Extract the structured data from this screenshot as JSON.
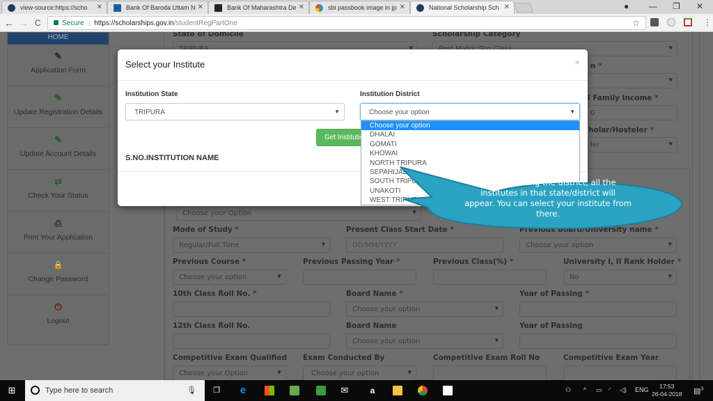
{
  "browser": {
    "tabs": [
      {
        "label": "view-source:https://scho",
        "icon": "nsp-favicon",
        "active": false
      },
      {
        "label": "Bank Of Baroda Uttam N",
        "icon": "bob-favicon",
        "active": false
      },
      {
        "label": "Bank Of Maharashtra De",
        "icon": "bom-favicon",
        "active": false
      },
      {
        "label": "sbi passbook image in jp",
        "icon": "google-favicon",
        "active": false
      },
      {
        "label": "National Scholarship Sch",
        "icon": "nsp-favicon",
        "active": true
      }
    ],
    "close_glyph": "✕",
    "window_controls": {
      "profile": "●",
      "minimize": "—",
      "restore": "❐",
      "close": "✕"
    },
    "nav": {
      "back": "←",
      "forward": "→",
      "reload": "C"
    },
    "address": {
      "secure_label": "Secure",
      "host": "https://scholarships.gov.in",
      "path": "/studentRegPartOne"
    },
    "star": "☆",
    "menu": "⋮"
  },
  "sidebar": {
    "home_label": "HOME",
    "items": [
      {
        "label": "Application Form",
        "icon": "edit-icon",
        "glyph": "✎",
        "color": "#2a2a2a"
      },
      {
        "label": "Update Registration Details",
        "icon": "edit-icon",
        "glyph": "✎",
        "color": "#1f5d1f"
      },
      {
        "label": "Update Account Details",
        "icon": "edit-icon",
        "glyph": "✎",
        "color": "#1f5d1f"
      },
      {
        "label": "Check Your Status",
        "icon": "exchange-icon",
        "glyph": "⇄",
        "color": "#1f5d1f"
      },
      {
        "label": "Print Your Application",
        "icon": "print-icon",
        "glyph": "⎙",
        "color": "#2a2a2a"
      },
      {
        "label": "Change Password",
        "icon": "lock-icon",
        "glyph": "🔒",
        "color": "#2a2a2a"
      },
      {
        "label": "Logout",
        "icon": "power-icon",
        "glyph": "⏻",
        "color": "#6b1010"
      }
    ]
  },
  "form": {
    "state_of_domicile": {
      "label": "State of Domicile",
      "value": "TRIPURA"
    },
    "scholarship_category": {
      "label": "Scholarship Category",
      "value": "Post Matric/Top Class"
    },
    "religion": {
      "label_fragment": "n"
    },
    "annual_family_income": {
      "label_fragment": "l Family Income",
      "value_fragment": "0"
    },
    "day_scholar": {
      "label_fragment": "holar/Hosteler",
      "value_fragment": "ler"
    },
    "course_select": {
      "value": "Choose your Option"
    },
    "mode_of_study": {
      "label": "Mode of Study",
      "value": "Regular/Full Time"
    },
    "present_class_start_date": {
      "label": "Present Class Start Date",
      "placeholder": "DD/MM/YYYY"
    },
    "previous_board": {
      "label": "Previous Board/University name",
      "value": "Choose your option"
    },
    "previous_course": {
      "label": "Previous Course",
      "value": "Choose your option"
    },
    "previous_passing_year": {
      "label": "Previous Passing Year",
      "value": ""
    },
    "previous_class_pct": {
      "label": "Previous Class(%)",
      "value": ""
    },
    "rank_holder": {
      "label": "University I, II Rank Holder",
      "value": "No"
    },
    "roll_10": {
      "label": "10th Class Roll No.",
      "value": ""
    },
    "board_10": {
      "label": "Board Name",
      "value": "Choose your option"
    },
    "year_10": {
      "label": "Year of Passing",
      "value": ""
    },
    "roll_12": {
      "label": "12th Class Roll No.",
      "value": ""
    },
    "board_12": {
      "label": "Board Name",
      "value": "Choose your option"
    },
    "year_12": {
      "label": "Year of Passing",
      "value": ""
    },
    "comp_exam": {
      "label": "Competitive Exam Qualified",
      "value": "Choose your Option"
    },
    "exam_conducted_by": {
      "label": "Exam Conducted By",
      "value": "Choose your option"
    },
    "comp_roll": {
      "label": "Competitive Exam Roll No",
      "value": ""
    },
    "comp_year": {
      "label": "Competitive Exam Year",
      "value": ""
    },
    "required_marker": "*",
    "arrow": "▼"
  },
  "modal": {
    "title": "Select your Institute",
    "close": "×",
    "state_label": "Institution State",
    "state_value": "TRIPURA",
    "district_label": "Institution District",
    "district_value": "Choose your option",
    "get_button": "Get Institutions",
    "table_header": "S.NO.INSTITUTION NAME",
    "district_options": [
      "Choose your option",
      "DHALAI",
      "GOMATI",
      "KHOWAI",
      "NORTH TRIPURA",
      "SEPAHIJALA",
      "SOUTH TRIPURA",
      "UNAKOTI",
      "WEST TRIPURA"
    ],
    "selected_option": "Choose your option"
  },
  "callout": {
    "text": "Upon selecting the district, all the institutes in that state/district will appear. You can select your institute from there.",
    "color": "#2aa3c2"
  },
  "taskbar": {
    "search_placeholder": "Type here to search",
    "time": "17:53",
    "date": "26-04-2018",
    "language": "ENG",
    "notifications": "3"
  }
}
